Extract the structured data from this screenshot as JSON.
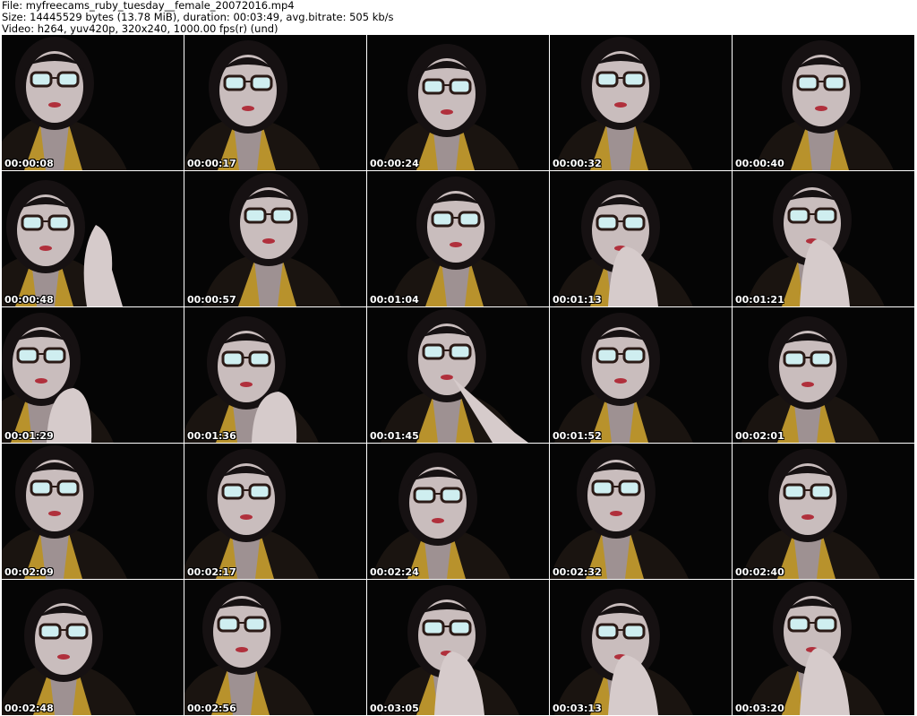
{
  "header": {
    "file_line": "File: myfreecams_ruby_tuesday__female_20072016.mp4",
    "size_line": "Size: 14445529 bytes (13.78 MiB), duration: 00:03:49, avg.bitrate: 505 kb/s",
    "video_line": "Video: h264, yuv420p, 320x240, 1000.00 fps(r) (und)"
  },
  "thumbnails": [
    {
      "timestamp": "00:00:08",
      "pose": "plain"
    },
    {
      "timestamp": "00:00:17",
      "pose": "plain"
    },
    {
      "timestamp": "00:00:24",
      "pose": "plain"
    },
    {
      "timestamp": "00:00:32",
      "pose": "plain"
    },
    {
      "timestamp": "00:00:40",
      "pose": "plain"
    },
    {
      "timestamp": "00:00:48",
      "pose": "hand-right"
    },
    {
      "timestamp": "00:00:57",
      "pose": "plain"
    },
    {
      "timestamp": "00:01:04",
      "pose": "plain"
    },
    {
      "timestamp": "00:01:13",
      "pose": "hand-mouth"
    },
    {
      "timestamp": "00:01:21",
      "pose": "hand-mouth"
    },
    {
      "timestamp": "00:01:29",
      "pose": "hand-chin"
    },
    {
      "timestamp": "00:01:36",
      "pose": "hand-chin"
    },
    {
      "timestamp": "00:01:45",
      "pose": "finger-lip"
    },
    {
      "timestamp": "00:01:52",
      "pose": "plain"
    },
    {
      "timestamp": "00:02:01",
      "pose": "plain"
    },
    {
      "timestamp": "00:02:09",
      "pose": "plain"
    },
    {
      "timestamp": "00:02:17",
      "pose": "plain"
    },
    {
      "timestamp": "00:02:24",
      "pose": "plain"
    },
    {
      "timestamp": "00:02:32",
      "pose": "plain"
    },
    {
      "timestamp": "00:02:40",
      "pose": "plain"
    },
    {
      "timestamp": "00:02:48",
      "pose": "plain"
    },
    {
      "timestamp": "00:02:56",
      "pose": "plain"
    },
    {
      "timestamp": "00:03:05",
      "pose": "hand-mouth"
    },
    {
      "timestamp": "00:03:13",
      "pose": "hand-mouth"
    },
    {
      "timestamp": "00:03:20",
      "pose": "hand-mouth"
    }
  ],
  "colors": {
    "background": "#ffffff",
    "frame": "#050505",
    "skin": "#c9bdbd",
    "hair": "#161112",
    "robe": "#b8922c",
    "lips": "#b0303c",
    "glasses": "#2a1a16",
    "glare": "#cfeef0"
  }
}
